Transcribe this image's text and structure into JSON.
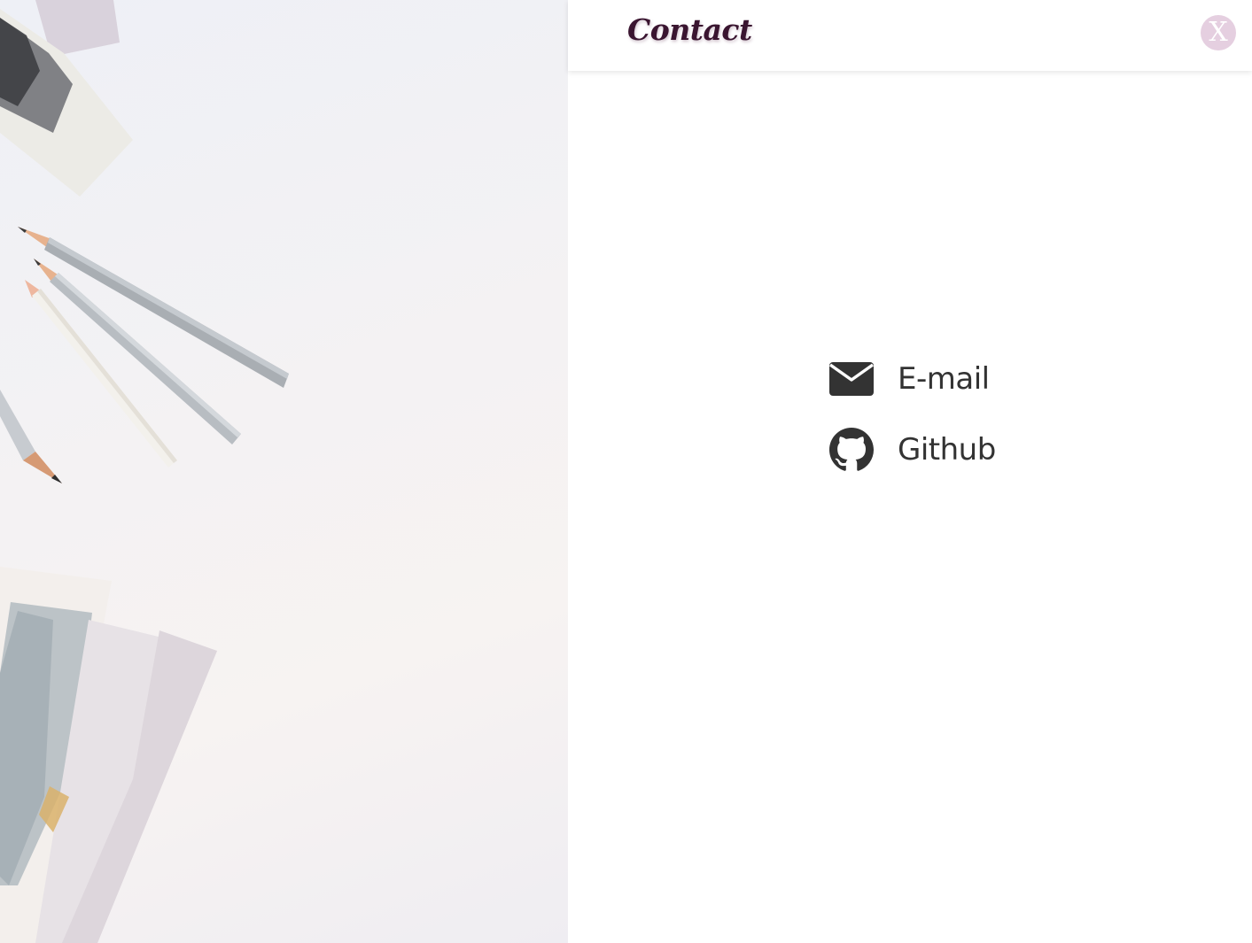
{
  "header": {
    "title": "Contact",
    "close_label": "X"
  },
  "links": [
    {
      "label": "E-mail",
      "icon": "envelope-icon"
    },
    {
      "label": "Github",
      "icon": "github-icon"
    }
  ],
  "colors": {
    "title": "#3a1530",
    "close_bg": "#e5cfe0",
    "link_text": "#333333"
  }
}
